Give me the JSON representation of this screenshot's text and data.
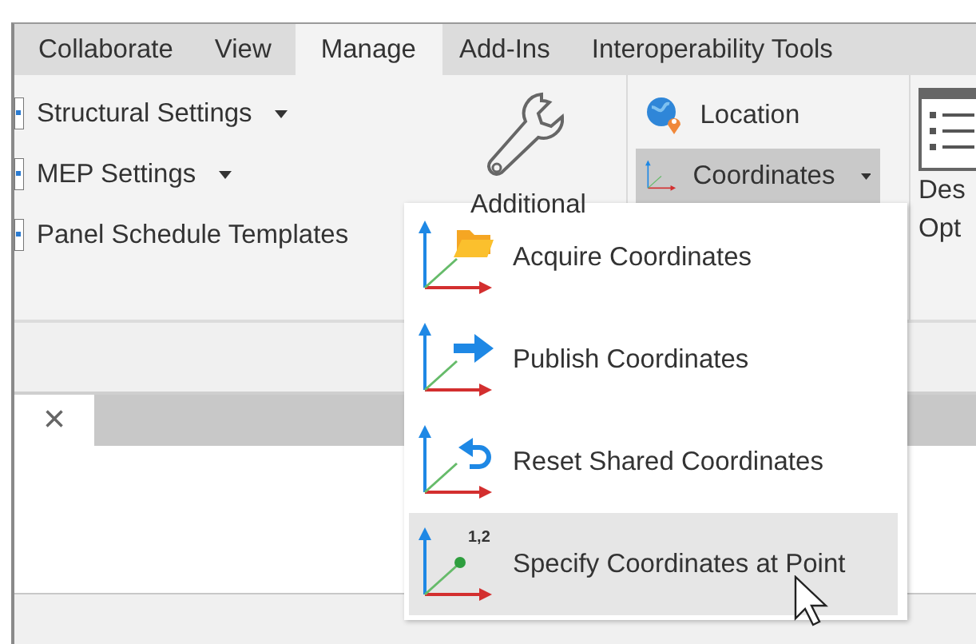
{
  "ribbon_tabs": [
    {
      "label": "Collaborate",
      "selected": false
    },
    {
      "label": "View",
      "selected": false
    },
    {
      "label": "Manage",
      "selected": true
    },
    {
      "label": "Add-Ins",
      "selected": false
    },
    {
      "label": "Interoperability Tools",
      "selected": false
    }
  ],
  "ribbon": {
    "settings": [
      {
        "label": "Structural  Settings",
        "dropdown": true
      },
      {
        "label": "MEP  Settings",
        "dropdown": true
      },
      {
        "label": "Panel Schedule  Templates",
        "dropdown": false
      }
    ],
    "additional": {
      "label": "Additional"
    },
    "location": {
      "label": "Location"
    },
    "coordinates": {
      "label": "Coordinates",
      "selected": true,
      "dropdown": true
    },
    "cut_button": {
      "lines": [
        "Des",
        "Opt"
      ]
    }
  },
  "document_tab": {
    "close": "×"
  },
  "menu": {
    "items": [
      {
        "label": "Acquire Coordinates",
        "kind": "acquire",
        "selected": false
      },
      {
        "label": "Publish Coordinates",
        "kind": "publish",
        "selected": false
      },
      {
        "label": "Reset Shared Coordinates",
        "kind": "reset",
        "selected": false
      },
      {
        "label": "Specify Coordinates at Point",
        "kind": "specify",
        "badge": "1,2",
        "selected": true
      }
    ]
  }
}
